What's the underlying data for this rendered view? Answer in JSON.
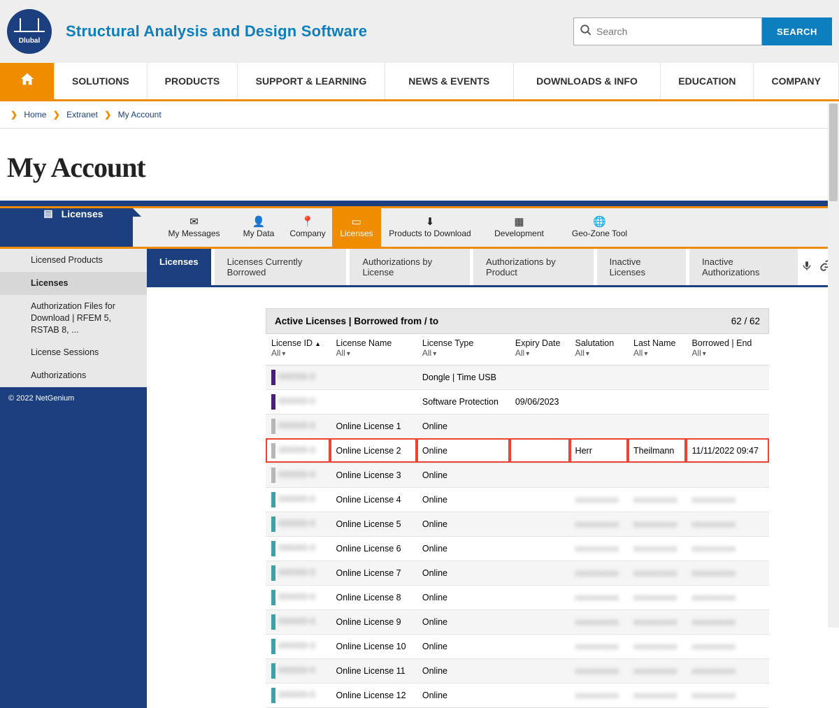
{
  "header": {
    "logo_text": "Dlubal",
    "tagline": "Structural Analysis and Design Software",
    "search_placeholder": "Search",
    "search_button": "SEARCH"
  },
  "mainnav": [
    "SOLUTIONS",
    "PRODUCTS",
    "SUPPORT & LEARNING",
    "NEWS & EVENTS",
    "DOWNLOADS & INFO",
    "EDUCATION",
    "COMPANY"
  ],
  "breadcrumb": {
    "home": "Home",
    "extranet": "Extranet",
    "current": "My Account"
  },
  "page_title": "My Account",
  "icon_tabs": {
    "licenses_sidebar": "Licenses",
    "my_messages": "My Messages",
    "my_data": "My Data",
    "company": "Company",
    "licenses": "Licenses",
    "products_to_download": "Products to Download",
    "development": "Development",
    "geo_zone_tool": "Geo-Zone Tool"
  },
  "sidebar": {
    "items": [
      "Licensed Products",
      "Licenses",
      "Authorization Files for Download | RFEM 5, RSTAB 8, ...",
      "License Sessions",
      "Authorizations"
    ],
    "footer": "© 2022 NetGenium"
  },
  "subtabs": [
    "Licenses",
    "Licenses Currently Borrowed",
    "Authorizations by License",
    "Authorizations by Product",
    "Inactive Licenses",
    "Inactive Authorizations"
  ],
  "table": {
    "title": "Active Licenses | Borrowed from / to",
    "count": "62 / 62",
    "columns": [
      {
        "name": "License ID",
        "filter": "All"
      },
      {
        "name": "License Name",
        "filter": "All"
      },
      {
        "name": "License Type",
        "filter": "All"
      },
      {
        "name": "Expiry Date",
        "filter": "All"
      },
      {
        "name": "Salutation",
        "filter": "All"
      },
      {
        "name": "Last Name",
        "filter": "All"
      },
      {
        "name": "Borrowed | End",
        "filter": "All"
      }
    ],
    "rows": [
      {
        "name": "",
        "type": "Dongle | Time USB",
        "expiry": "",
        "sal": "",
        "last": "",
        "borrow": ""
      },
      {
        "name": "",
        "type": "Software Protection",
        "expiry": "09/06/2023",
        "sal": "",
        "last": "",
        "borrow": ""
      },
      {
        "name": "Online License 1",
        "type": "Online",
        "expiry": "",
        "sal": "",
        "last": "",
        "borrow": ""
      },
      {
        "name": "Online License 2",
        "type": "Online",
        "expiry": "",
        "sal": "Herr",
        "last": "Theilmann",
        "borrow": "11/11/2022 09:47",
        "highlight": true
      },
      {
        "name": "Online License 3",
        "type": "Online",
        "expiry": "",
        "sal": "",
        "last": "",
        "borrow": ""
      },
      {
        "name": "Online License 4",
        "type": "Online",
        "expiry": "",
        "sal": "blur",
        "last": "blur",
        "borrow": "blur"
      },
      {
        "name": "Online License 5",
        "type": "Online",
        "expiry": "",
        "sal": "blur",
        "last": "blur",
        "borrow": "blur"
      },
      {
        "name": "Online License 6",
        "type": "Online",
        "expiry": "",
        "sal": "blur",
        "last": "blur",
        "borrow": "blur"
      },
      {
        "name": "Online License 7",
        "type": "Online",
        "expiry": "",
        "sal": "blur",
        "last": "blur",
        "borrow": "blur"
      },
      {
        "name": "Online License 8",
        "type": "Online",
        "expiry": "",
        "sal": "blur",
        "last": "blur",
        "borrow": "blur"
      },
      {
        "name": "Online License 9",
        "type": "Online",
        "expiry": "",
        "sal": "blur",
        "last": "blur",
        "borrow": "blur"
      },
      {
        "name": "Online License 10",
        "type": "Online",
        "expiry": "",
        "sal": "blur",
        "last": "blur",
        "borrow": "blur"
      },
      {
        "name": "Online License 11",
        "type": "Online",
        "expiry": "",
        "sal": "blur",
        "last": "blur",
        "borrow": "blur"
      },
      {
        "name": "Online License 12",
        "type": "Online",
        "expiry": "",
        "sal": "blur",
        "last": "blur",
        "borrow": "blur"
      }
    ]
  }
}
